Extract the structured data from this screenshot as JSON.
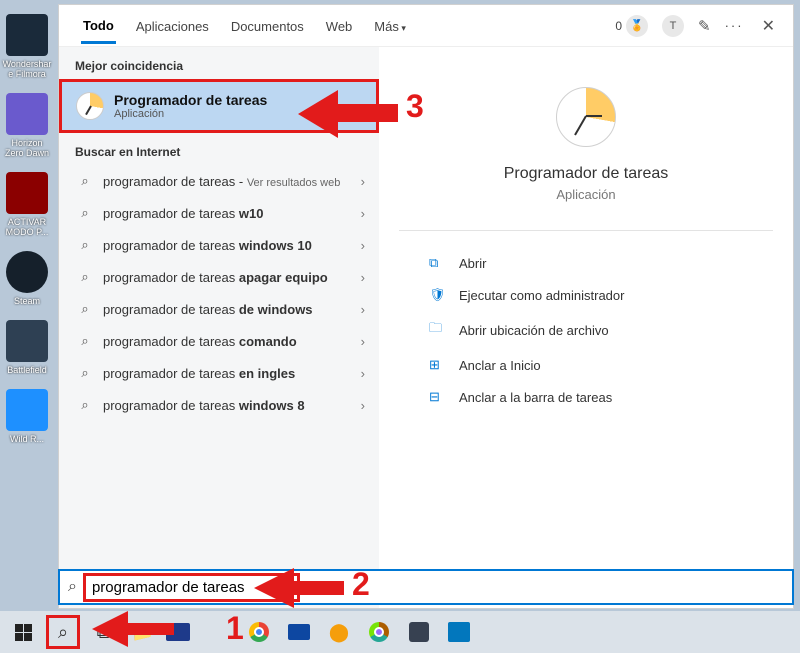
{
  "desktop": [
    {
      "label": "Wondershare Filmora"
    },
    {
      "label": "Horizon Zero Dawn"
    },
    {
      "label": "ACTIVAR MODO P..."
    },
    {
      "label": "Steam"
    },
    {
      "label": "Battlefield"
    },
    {
      "label": "Wild R..."
    }
  ],
  "tabs": {
    "todo": "Todo",
    "apps": "Aplicaciones",
    "docs": "Documentos",
    "web": "Web",
    "more": "Más"
  },
  "topRight": {
    "points": "0",
    "avatar": "T"
  },
  "sections": {
    "best": "Mejor coincidencia",
    "web": "Buscar en Internet"
  },
  "bestMatch": {
    "title": "Programador de tareas",
    "subtitle": "Aplicación"
  },
  "webResults": [
    {
      "pre": "programador de tareas",
      "bold": "",
      "suf": " - ",
      "sub": "Ver resultados web"
    },
    {
      "pre": "programador de tareas ",
      "bold": "w10",
      "suf": ""
    },
    {
      "pre": "programador de tareas ",
      "bold": "windows 10",
      "suf": ""
    },
    {
      "pre": "programador de tareas ",
      "bold": "apagar equipo",
      "suf": ""
    },
    {
      "pre": "programador de tareas ",
      "bold": "de windows",
      "suf": ""
    },
    {
      "pre": "programador de tareas ",
      "bold": "comando",
      "suf": ""
    },
    {
      "pre": "programador de tareas ",
      "bold": "en ingles",
      "suf": ""
    },
    {
      "pre": "programador de tareas ",
      "bold": "windows 8",
      "suf": ""
    }
  ],
  "preview": {
    "name": "Programador de tareas",
    "sub": "Aplicación",
    "actions": [
      {
        "icon": "open-icon",
        "label": "Abrir"
      },
      {
        "icon": "admin-icon",
        "label": "Ejecutar como administrador"
      },
      {
        "icon": "folder-icon",
        "label": "Abrir ubicación de archivo"
      },
      {
        "icon": "pin-start-icon",
        "label": "Anclar a Inicio"
      },
      {
        "icon": "pin-taskbar-icon",
        "label": "Anclar a la barra de tareas"
      }
    ]
  },
  "searchInput": {
    "value": "programador de tareas"
  },
  "annotations": {
    "n1": "1",
    "n2": "2",
    "n3": "3"
  }
}
